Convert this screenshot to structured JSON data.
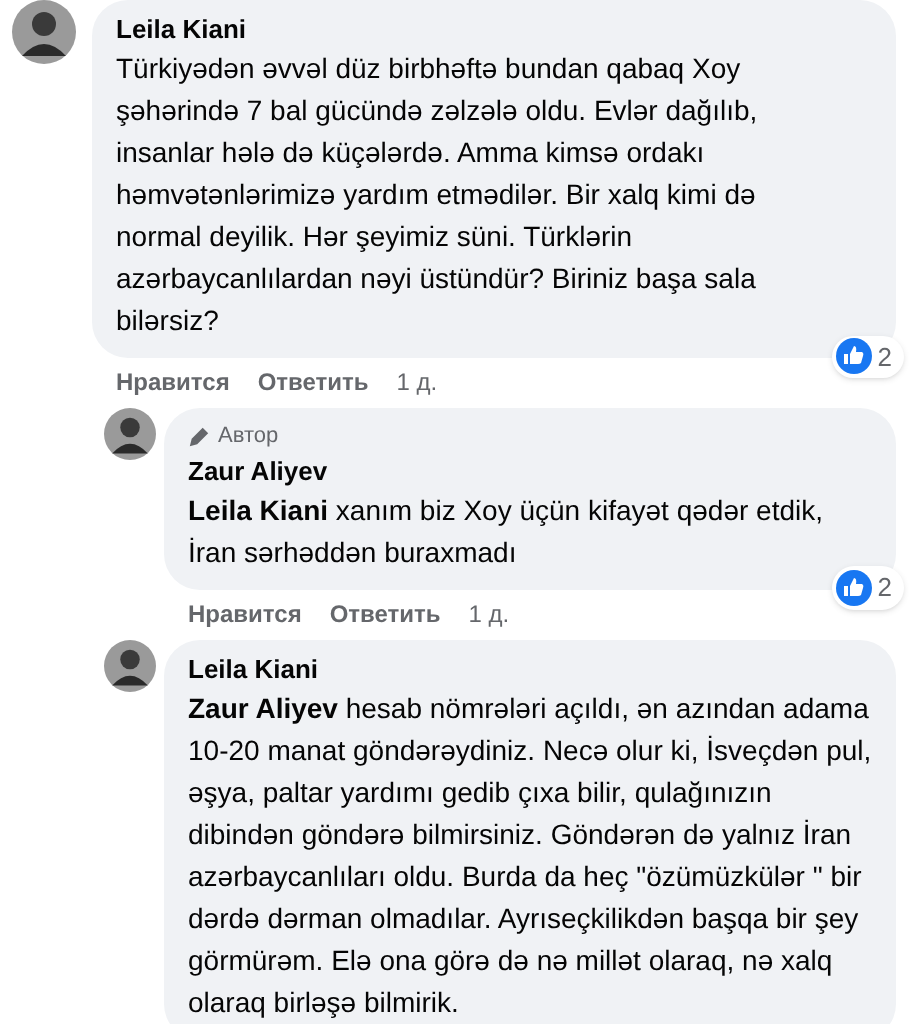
{
  "comments": [
    {
      "author": "Leila Kiani",
      "text": "Türkiyədən əvvəl düz birbhəftə bundan qabaq Xoy şəhərində 7 bal gücündə zəlzələ oldu. Evlər dağılıb, insanlar hələ də küçələrdə. Amma kimsə ordakı həmvətənlərimizə yardım etmədilər. Bir xalq kimi də normal deyilik. Hər şeyimiz süni. Türklərin azərbaycanlılardan nəyi üstündür? Biriniz başa sala bilərsiz?",
      "reactions": "2",
      "actions": [
        "Нравится",
        "Ответить",
        "1 д."
      ],
      "reply": false
    },
    {
      "author": "Zaur Aliyev",
      "badge": "Автор",
      "mention": "Leila Kiani",
      "text": "xanım biz Xoy üçün kifayət qədər etdik, İran sərhəddən buraxmadı",
      "reactions": "2",
      "actions": [
        "Нравится",
        "Ответить",
        "1 д."
      ],
      "reply": true
    },
    {
      "author": "Leila Kiani",
      "mention": "Zaur Aliyev",
      "text": "hesab nömrələri açıldı, ən azından adama 10-20 manat göndərəydiniz. Necə olur ki, İsveçdən pul, əşya, paltar yardımı gedib çıxa bilir, qulağınızın dibindən göndərə bilmirsiniz. Göndərən də yalnız İran azərbaycanlıları oldu. Burda da heç \"özümüzkülər \" bir dərdə dərman olmadılar. Ayrıseçkilikdən başqa bir şey görmürəm. Elə ona görə də nə millət olaraq, nə xalq olaraq birləşə bilmirik.",
      "reply": true
    }
  ]
}
